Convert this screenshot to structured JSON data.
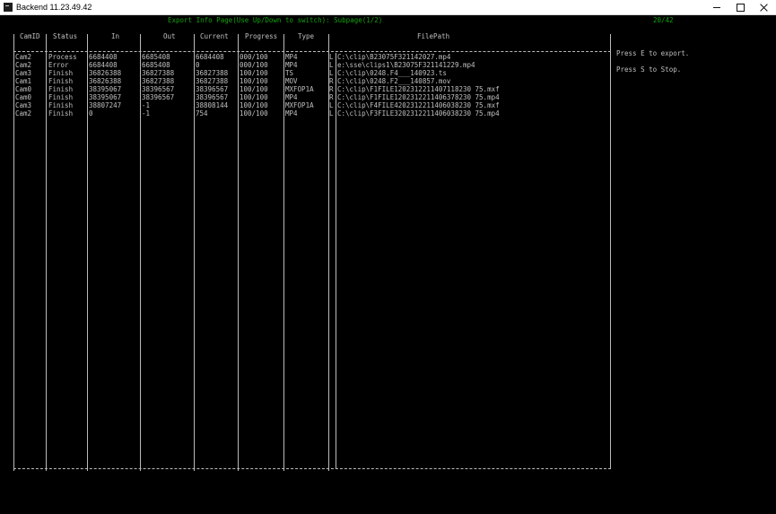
{
  "window": {
    "title": "Backend 11.23.49.42"
  },
  "console": {
    "header": "Export Info Page(Use Up/Down to switch): Subpage(1/2)",
    "counter": "20/42",
    "columns": [
      "CamID",
      "Status",
      "In",
      "Out",
      "Current",
      "Progress",
      "Type",
      "",
      "FilePath"
    ],
    "rows": [
      [
        "Cam2",
        "Process",
        "6684408",
        "6685408",
        "6684408",
        "000/100",
        "MP4",
        "L",
        "C:\\clip\\B23075F321142027.mp4"
      ],
      [
        "Cam2",
        "Error",
        "6684408",
        "6685408",
        "0",
        "000/100",
        "MP4",
        "L",
        "e:\\sse\\clips1\\B23075F321141229.mp4"
      ],
      [
        "Cam3",
        "Finish",
        "36826388",
        "36827388",
        "36827388",
        "100/100",
        "TS",
        "L",
        "C:\\clip\\0248.F4___140923.ts"
      ],
      [
        "Cam1",
        "Finish",
        "36826388",
        "36827388",
        "36827388",
        "100/100",
        "MOV",
        "R",
        "C:\\clip\\0248.F2___140857.mov"
      ],
      [
        "Cam0",
        "Finish",
        "38395067",
        "38396567",
        "38396567",
        "100/100",
        "MXFOP1A",
        "R",
        "C:\\clip\\F1FILE1202312211407118230 75.mxf"
      ],
      [
        "Cam0",
        "Finish",
        "38395067",
        "38396567",
        "38396567",
        "100/100",
        "MP4",
        "R",
        "C:\\clip\\F1FILE1202312211406378230 75.mp4"
      ],
      [
        "Cam3",
        "Finish",
        "38807247",
        "-1",
        "38808144",
        "100/100",
        "MXFOP1A",
        "L",
        "C:\\clip\\F4FILE4202312211406038230 75.mxf"
      ],
      [
        "Cam2",
        "Finish",
        "0",
        "-1",
        "754",
        "100/100",
        "MP4",
        "L",
        "C:\\clip\\F3FILE3202312211406038230 75.mp4"
      ]
    ],
    "hints": [
      "Press E to export.",
      "Press S to Stop."
    ]
  }
}
